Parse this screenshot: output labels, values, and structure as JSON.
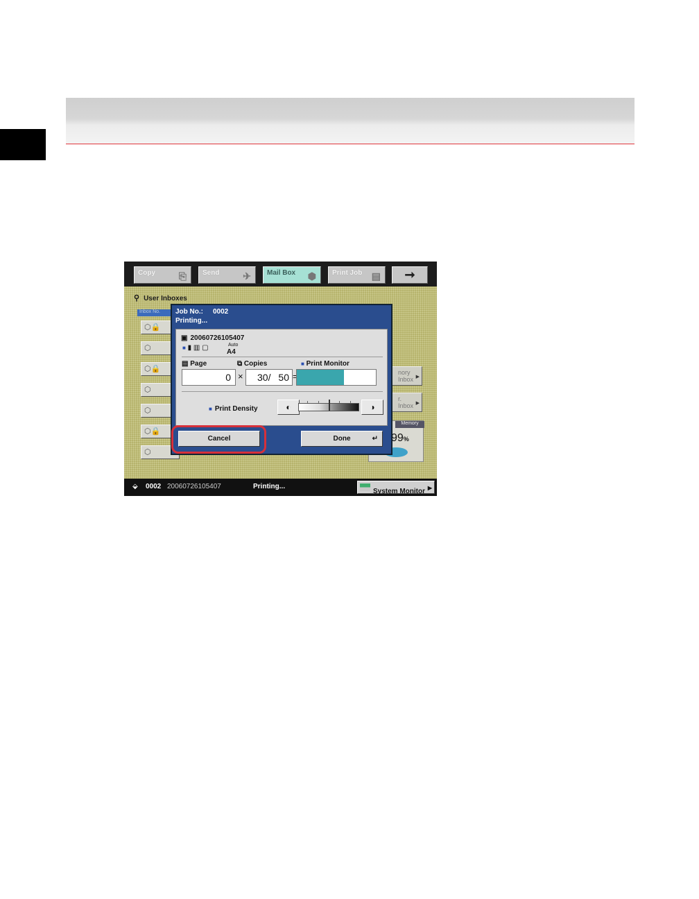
{
  "header": {
    "accent_color": "#e0363c"
  },
  "screen": {
    "tabs": [
      {
        "label": "Copy",
        "icon": "copy-icon"
      },
      {
        "label": "Send",
        "icon": "send-plane-icon"
      },
      {
        "label": "Mail Box",
        "icon": "mailbox-icon"
      },
      {
        "label": "Print Job",
        "icon": "printer-icon"
      },
      {
        "label": "",
        "icon": "arrow-right-icon"
      }
    ],
    "active_tab": "Mail Box",
    "inbox_title": "User Inboxes",
    "inbox_header": "Inbox No.",
    "side_buttons": [
      "nory\nInbox",
      "r.\nInbox"
    ],
    "memory": {
      "label": "Memory",
      "value": "99",
      "unit": "%"
    },
    "dialog": {
      "job_label": "Job No.:",
      "job_no": "0002",
      "status": "Printing...",
      "doc_name": "20060726105407",
      "auto_label": "Auto",
      "paper": "A4",
      "page_label": "Page",
      "copies_label": "Copies",
      "monitor_label": "Print Monitor",
      "page_value": "0",
      "multiply": "×",
      "copies_value": "30/",
      "copies_total": "50",
      "equals": "=",
      "monitor_progress": 0.6,
      "density_label": "Print Density",
      "cancel_label": "Cancel",
      "done_label": "Done"
    },
    "statusbar": {
      "job_no": "0002",
      "doc_name": "20060726105407",
      "status": "Printing...",
      "system_monitor": "System Monitor"
    }
  }
}
